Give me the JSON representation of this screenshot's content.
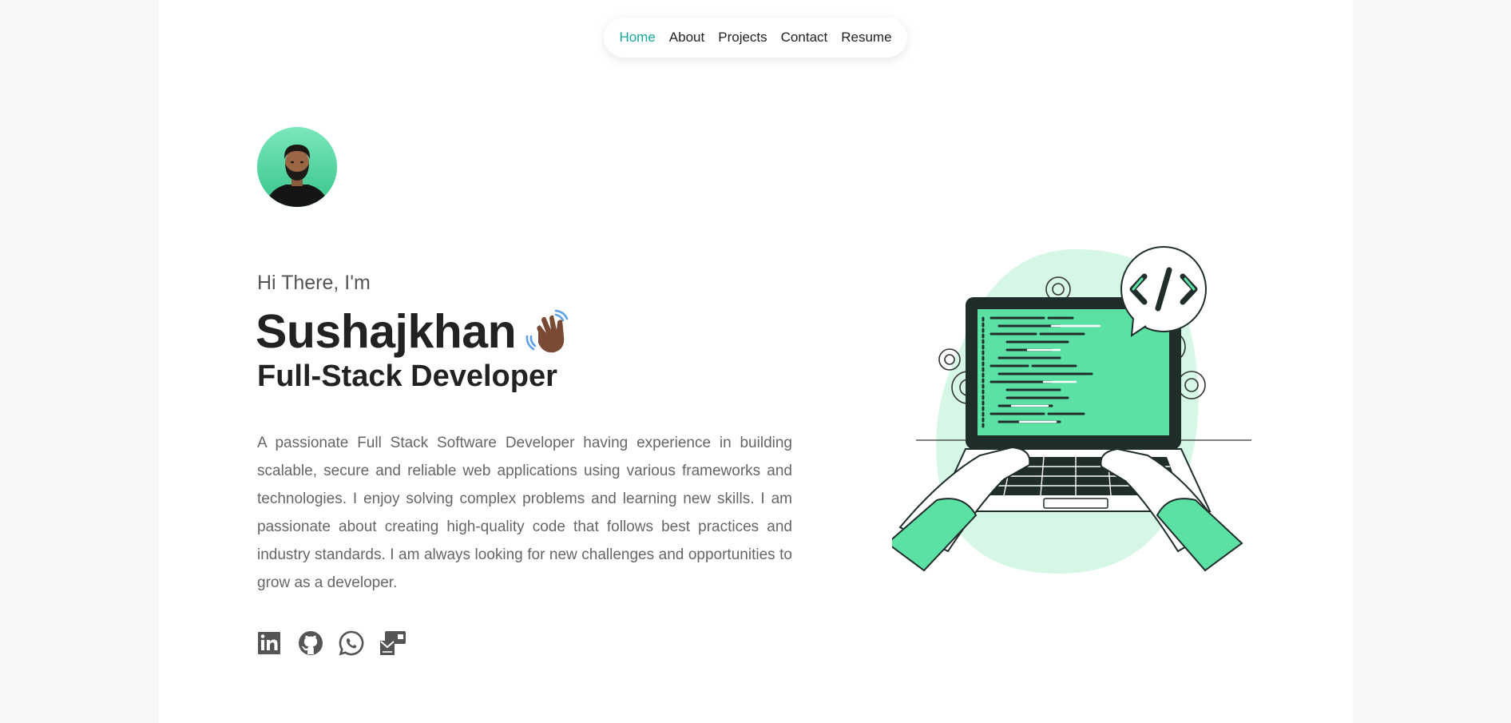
{
  "nav": {
    "items": [
      {
        "label": "Home",
        "active": true
      },
      {
        "label": "About",
        "active": false
      },
      {
        "label": "Projects",
        "active": false
      },
      {
        "label": "Contact",
        "active": false
      },
      {
        "label": "Resume",
        "active": false
      }
    ],
    "active_color": "#14a89a"
  },
  "hero": {
    "greeting": "Hi There, I'm",
    "name": "Sushajkhan",
    "wave_emoji": "👋🏾",
    "role": "Full-Stack Developer",
    "bio": "A passionate Full Stack Software Developer having experience in building scalable, secure and reliable web applications using various frameworks and technologies. I enjoy solving complex problems and learning new skills. I am passionate about creating high-quality code that follows best practices and industry standards. I am always looking for new challenges and opportunities to grow as a developer."
  },
  "socials": [
    {
      "icon": "linkedin-icon"
    },
    {
      "icon": "github-icon"
    },
    {
      "icon": "whatsapp-icon"
    },
    {
      "icon": "mail-icon"
    }
  ],
  "colors": {
    "accent": "#14a89a",
    "illustration_green": "#5ce1a4",
    "illustration_bg": "#d6f7e6",
    "text_dark": "#222222",
    "text_muted": "#666666"
  }
}
